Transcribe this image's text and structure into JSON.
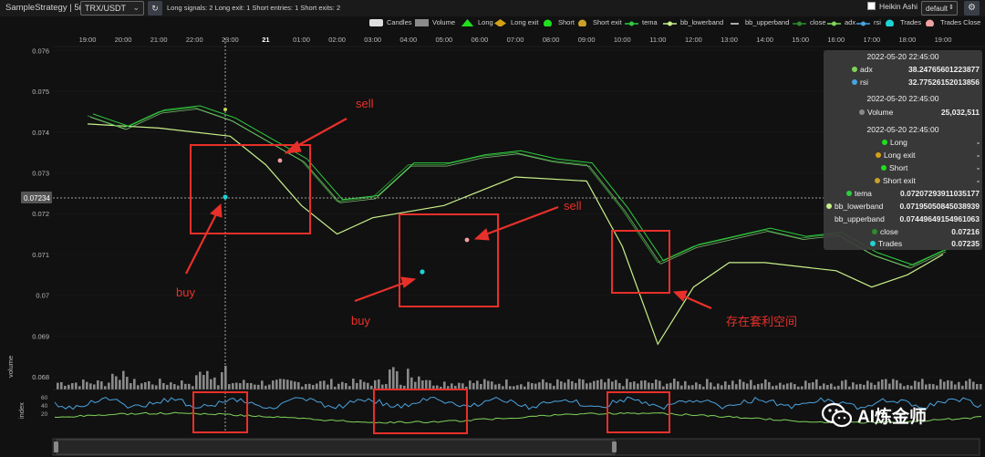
{
  "toolbar": {
    "strategy_label": "SampleStrategy | 5m",
    "pair": "TRX/USDT",
    "refresh_icon": "refresh-icon",
    "stats": "Long signals: 2  Long exit: 1  Short entries: 1  Short exits: 2",
    "heikin_ashi_label": "Heikin Ashi",
    "heikin_ashi_checked": false,
    "layout_select": "default",
    "settings_icon": "gear-icon"
  },
  "legend": [
    {
      "label": "Candles",
      "color": "#dddddd"
    },
    {
      "label": "Volume",
      "color": "#8a8a8a"
    },
    {
      "label": "Long",
      "color": "#1ee01e"
    },
    {
      "label": "Long exit",
      "color": "#d4a017"
    },
    {
      "label": "Short",
      "color": "#1ee01e"
    },
    {
      "label": "Short exit",
      "color": "#c9a227"
    },
    {
      "label": "tema",
      "color": "#2ecc40"
    },
    {
      "label": "bb_lowerband",
      "color": "#c9f08a"
    },
    {
      "label": "bb_upperband",
      "color": "#dddddd"
    },
    {
      "label": "close",
      "color": "#2e8b2e"
    },
    {
      "label": "adx",
      "color": "#7fd45a"
    },
    {
      "label": "rsi",
      "color": "#4aa3df"
    },
    {
      "label": "Trades",
      "color": "#1fd3d3"
    },
    {
      "label": "Trades Close",
      "color": "#f0a0a0"
    }
  ],
  "chart_data": {
    "type": "line",
    "x_ticks": [
      "19:00",
      "20:00",
      "21:00",
      "22:00",
      "23:00",
      "21",
      "01:00",
      "02:00",
      "03:00",
      "04:00",
      "05:00",
      "06:00",
      "07:00",
      "08:00",
      "09:00",
      "10:00",
      "11:00",
      "12:00",
      "13:00",
      "14:00",
      "15:00",
      "16:00",
      "17:00",
      "18:00",
      "19:00"
    ],
    "y_ticks": [
      "0.076",
      "0.075",
      "0.074",
      "0.073",
      "0.072",
      "0.071",
      "0.07",
      "0.069",
      "0.068"
    ],
    "y_range": [
      0.0678,
      0.0763
    ],
    "current_price_label": "0.07234",
    "volume_axis_label": "volume",
    "index_axis_label": "index",
    "index_ticks": [
      "60",
      "40",
      "20"
    ],
    "series": [
      {
        "name": "close",
        "x": [
          0,
          1,
          2,
          3,
          4,
          5,
          6,
          7,
          8,
          9,
          10,
          11,
          12,
          13,
          14,
          15,
          16,
          17,
          18,
          19,
          20,
          21,
          22,
          23,
          24
        ],
        "y": [
          0.0744,
          0.0741,
          0.0745,
          0.0746,
          0.0743,
          0.0738,
          0.0733,
          0.0723,
          0.0724,
          0.0732,
          0.0732,
          0.0734,
          0.0735,
          0.0733,
          0.0732,
          0.0721,
          0.0708,
          0.0712,
          0.0714,
          0.0716,
          0.0714,
          0.0715,
          0.071,
          0.0707,
          0.0711
        ]
      },
      {
        "name": "bb_lowerband",
        "x": [
          0,
          2,
          4,
          5,
          6,
          7,
          8,
          10,
          12,
          14,
          15,
          16,
          17,
          18,
          19,
          20,
          21,
          22,
          23,
          24
        ],
        "y": [
          0.0742,
          0.0741,
          0.0739,
          0.0732,
          0.0722,
          0.0715,
          0.0719,
          0.0722,
          0.0729,
          0.0728,
          0.0712,
          0.0688,
          0.0702,
          0.0708,
          0.0708,
          0.0707,
          0.0706,
          0.0702,
          0.0705,
          0.071
        ]
      }
    ]
  },
  "tooltip": {
    "time1": "2022-05-20 22:45:00",
    "adx_label": "adx",
    "adx_value": "38.24765601223877",
    "rsi_label": "rsi",
    "rsi_value": "32.77526152013856",
    "time2": "2022-05-20 22:45:00",
    "volume_label": "Volume",
    "volume_value": "25,032,511",
    "time3": "2022-05-20 22:45:00",
    "long_label": "Long",
    "long_value": "-",
    "long_exit_label": "Long exit",
    "long_exit_value": "-",
    "short_label": "Short",
    "short_value": "-",
    "short_exit_label": "Short exit",
    "short_exit_value": "-",
    "tema_label": "tema",
    "tema_value": "0.07207293911035177",
    "bblow_label": "bb_lowerband",
    "bblow_value": "0.07195050845038939",
    "bbup_label": "bb_upperband",
    "bbup_value": "0.07449649154961063",
    "close_label": "close",
    "close_value": "0.07216",
    "trades_label": "Trades",
    "trades_value": "0.07235"
  },
  "annotations": {
    "sell1": "sell",
    "sell2": "sell",
    "buy1": "buy",
    "buy2": "buy",
    "arb": "存在套利空间"
  },
  "watermark": {
    "text": "AI炼金师",
    "icon": "wechat-icon"
  }
}
